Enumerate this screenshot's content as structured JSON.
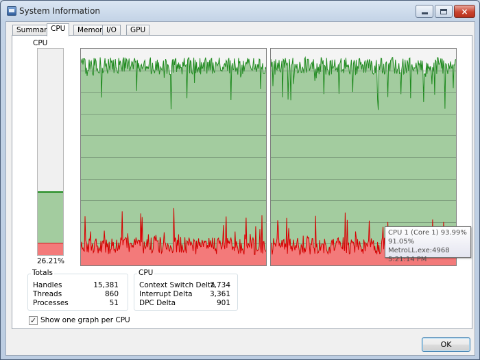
{
  "window": {
    "title": "System Information"
  },
  "window_controls": {
    "close": "×"
  },
  "tabs": [
    {
      "label": "Summary",
      "active": false
    },
    {
      "label": "CPU",
      "active": true
    },
    {
      "label": "Memory",
      "active": false
    },
    {
      "label": "I/O",
      "active": false
    },
    {
      "label": "GPU",
      "active": false
    }
  ],
  "cpu_meter": {
    "label": "CPU",
    "percent_text": "26.21%",
    "total_fraction": 0.31,
    "kernel_fraction": 0.06
  },
  "graphs": {
    "core_count": 2,
    "colors": {
      "total": "#1f8a1f",
      "total_fill": "#a3cc9f",
      "kernel": "#d40000",
      "kernel_fill": "#f37a7a",
      "grid": "#6e8a6e"
    }
  },
  "tooltip": {
    "line1": "CPU 1 (Core 1) 93.99%",
    "line2": "91.05% MetroLL.exe:4968",
    "line3": "5:21:14 PM"
  },
  "totals": {
    "title": "Totals",
    "rows": [
      {
        "label": "Handles",
        "value": "15,381"
      },
      {
        "label": "Threads",
        "value": "860"
      },
      {
        "label": "Processes",
        "value": "51"
      }
    ]
  },
  "cpu_stats": {
    "title": "CPU",
    "rows": [
      {
        "label": "Context Switch Delta",
        "value": "7,734"
      },
      {
        "label": "Interrupt Delta",
        "value": "3,361"
      },
      {
        "label": "DPC Delta",
        "value": "901"
      }
    ]
  },
  "options": {
    "one_graph_per_cpu_label": "Show one graph per CPU",
    "one_graph_per_cpu_checked": true,
    "check_glyph": "✓"
  },
  "buttons": {
    "ok": "OK"
  }
}
